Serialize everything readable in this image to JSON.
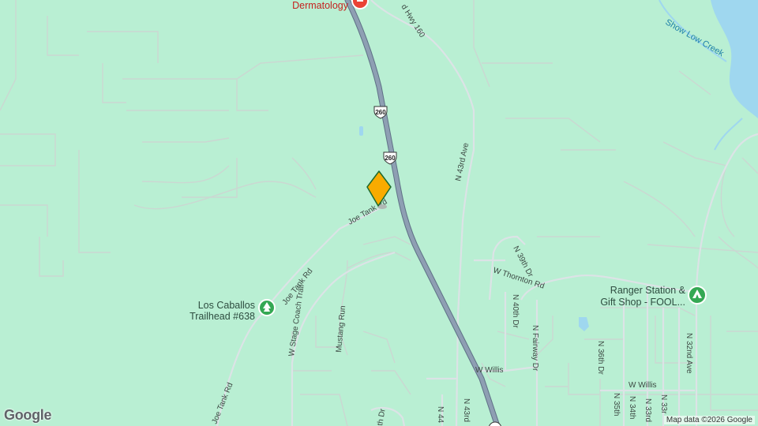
{
  "map": {
    "background_color": "#b9efd3",
    "road_color": "#d7dbe0",
    "highway_color": "#8e9fb3",
    "water_color": "#9fd7ef",
    "marker_color": "#f9ab00",
    "logo": "Google",
    "attribution": "Map data ©2026 Google"
  },
  "highway": {
    "shield_1": "260",
    "shield_2": "260",
    "label_hwy160": "d Hwy 160"
  },
  "streets": {
    "joe_tank_rd_top": "Joe Tank Rd",
    "joe_tank_rd_mid": "Joe Tank Rd",
    "joe_tank_rd_bottom": "Joe Tank Rd",
    "w_stage_coach_trail": "W Stage Coach Trail",
    "mustang_run": "Mustang Run",
    "n_43rd_ave": "N 43rd Ave",
    "n_39th_dr": "N 39th Dr",
    "w_thornton_rd": "W Thornton Rd",
    "n_40th_dr": "N 40th Dr",
    "n_fairway_dr": "N Fairway Dr",
    "w_willis_1": "W Willis",
    "w_willis_2": "W Willis",
    "n_36th_dr": "N 36th Dr",
    "n_32nd_ave": "N 32nd Ave",
    "n_35th": "N 35th",
    "n_34th": "N 34th",
    "n_33rd": "N 33rd",
    "n_33r": "N 33r",
    "n_44": "N 44",
    "n_43rd_bottom": "N 43rd",
    "th_dr": "th Dr"
  },
  "pois": {
    "dermatology": "Dermatology",
    "trailhead_line1": "Los Caballos",
    "trailhead_line2": "Trailhead #638",
    "ranger_line1": "Ranger Station &",
    "ranger_line2": "Gift Shop - FOOL..."
  },
  "water": {
    "creek": "Show Low Creek"
  }
}
